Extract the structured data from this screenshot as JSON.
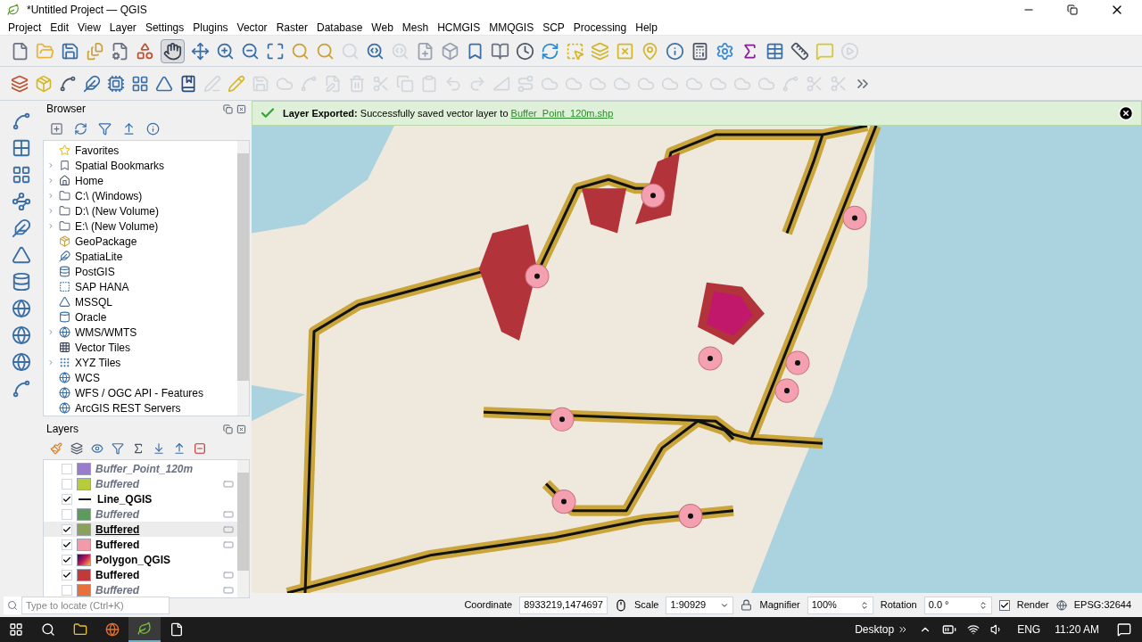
{
  "window": {
    "title": "*Untitled Project — QGIS"
  },
  "menu": [
    "Project",
    "Edit",
    "View",
    "Layer",
    "Settings",
    "Plugins",
    "Vector",
    "Raster",
    "Database",
    "Web",
    "Mesh",
    "HCMGIS",
    "MMQGIS",
    "SCP",
    "Processing",
    "Help"
  ],
  "browser": {
    "title": "Browser",
    "items": [
      {
        "label": "Favorites",
        "expandable": false
      },
      {
        "label": "Spatial Bookmarks",
        "expandable": true
      },
      {
        "label": "Home",
        "expandable": true
      },
      {
        "label": "C:\\ (Windows)",
        "expandable": true
      },
      {
        "label": "D:\\ (New Volume)",
        "expandable": true
      },
      {
        "label": "E:\\ (New Volume)",
        "expandable": true
      },
      {
        "label": "GeoPackage",
        "expandable": false
      },
      {
        "label": "SpatiaLite",
        "expandable": false
      },
      {
        "label": "PostGIS",
        "expandable": false
      },
      {
        "label": "SAP HANA",
        "expandable": false
      },
      {
        "label": "MSSQL",
        "expandable": false
      },
      {
        "label": "Oracle",
        "expandable": false
      },
      {
        "label": "WMS/WMTS",
        "expandable": true
      },
      {
        "label": "Vector Tiles",
        "expandable": false
      },
      {
        "label": "XYZ Tiles",
        "expandable": true
      },
      {
        "label": "WCS",
        "expandable": false
      },
      {
        "label": "WFS / OGC API - Features",
        "expandable": false
      },
      {
        "label": "ArcGIS REST Servers",
        "expandable": false
      }
    ]
  },
  "layers": {
    "title": "Layers",
    "items": [
      {
        "name": "Buffer_Point_120m",
        "checked": false,
        "selected": false,
        "kind": "fill",
        "color": "#9b7ccc",
        "indicator": false
      },
      {
        "name": "Buffered",
        "checked": false,
        "selected": false,
        "kind": "fill",
        "color": "#b8cc3a",
        "indicator": true
      },
      {
        "name": "Line_QGIS",
        "checked": true,
        "selected": false,
        "kind": "line",
        "color": "#1a1a1a",
        "indicator": false
      },
      {
        "name": "Buffered",
        "checked": false,
        "selected": false,
        "kind": "fill",
        "color": "#5e9a5e",
        "indicator": true
      },
      {
        "name": "Buffered",
        "checked": true,
        "selected": true,
        "kind": "fill",
        "color": "#8aa05c",
        "indicator": true
      },
      {
        "name": "Buffered",
        "checked": true,
        "selected": false,
        "kind": "fill",
        "color": "#f29aaa",
        "indicator": true
      },
      {
        "name": "Polygon_QGIS",
        "checked": true,
        "selected": false,
        "kind": "gradient",
        "indicator": false
      },
      {
        "name": "Buffered",
        "checked": true,
        "selected": false,
        "kind": "fill",
        "color": "#c0393b",
        "indicator": true
      },
      {
        "name": "Buffered",
        "checked": false,
        "selected": false,
        "kind": "fill",
        "color": "#e8703a",
        "indicator": true
      }
    ]
  },
  "message": {
    "title": "Layer Exported:",
    "text": "Successfully saved vector layer to",
    "link": "Buffer_Point_120m.shp"
  },
  "status_bar": {
    "locate_placeholder": "Type to locate (Ctrl+K)",
    "coordinate_label": "Coordinate",
    "coordinate": "8933219,1474697",
    "scale_label": "Scale",
    "scale": "1:90929",
    "magnifier_label": "Magnifier",
    "magnifier": "100%",
    "rotation_label": "Rotation",
    "rotation": "0.0 °",
    "render_label": "Render",
    "render_checked": true,
    "crs": "EPSG:32644"
  },
  "taskbar": {
    "desktop": "Desktop",
    "language": "ENG",
    "time": "11:20 AM"
  }
}
